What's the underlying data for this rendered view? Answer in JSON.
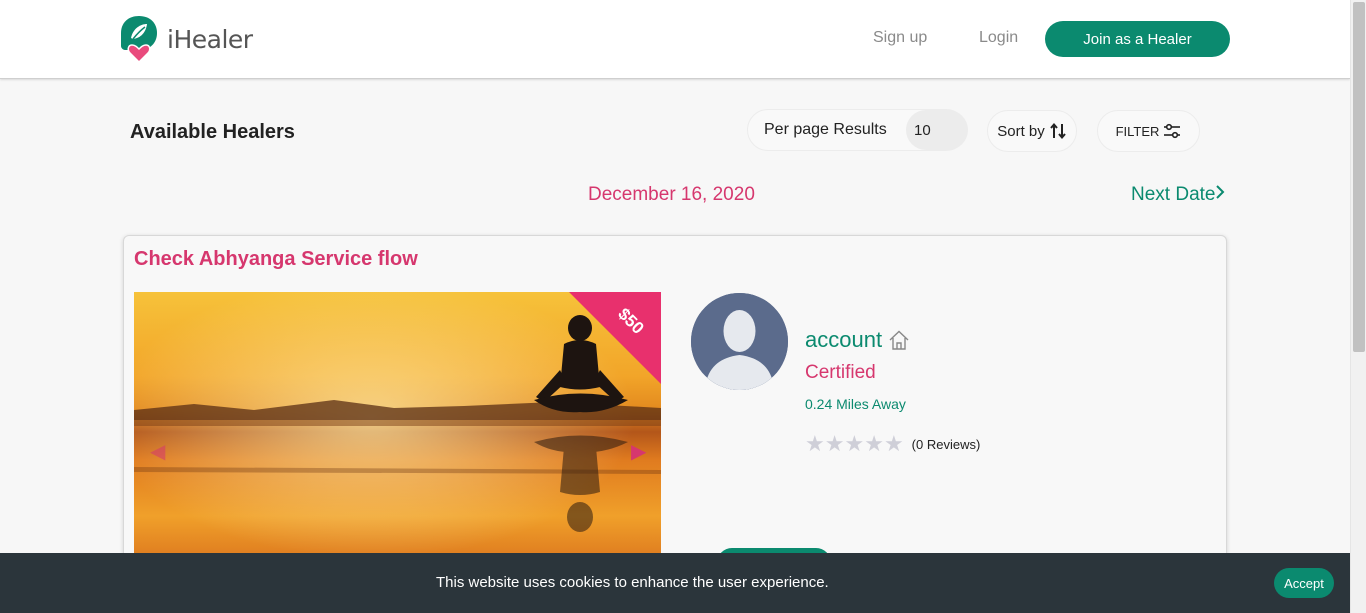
{
  "header": {
    "brand": "iHealer",
    "nav": {
      "signup": "Sign up",
      "login": "Login",
      "join": "Join as a Healer"
    }
  },
  "toolbar": {
    "heading": "Available Healers",
    "per_page_label": "Per page Results",
    "per_page_value": "10",
    "sort_label": "Sort by",
    "filter_label": "FILTER"
  },
  "date_nav": {
    "current": "December 16, 2020",
    "next": "Next Date"
  },
  "card": {
    "title": "Check Abhyanga Service flow",
    "price": "$50",
    "healer": {
      "name": "account",
      "status": "Certified",
      "distance": "0.24 Miles Away",
      "rating_stars": 0,
      "max_stars": 5,
      "reviews": "(0 Reviews)"
    }
  },
  "cookie": {
    "message": "This website uses cookies to enhance the user experience.",
    "accept": "Accept"
  },
  "colors": {
    "brand_green": "#0b8a6f",
    "brand_pink": "#d6376e",
    "cookie_bg": "#2b353b"
  }
}
